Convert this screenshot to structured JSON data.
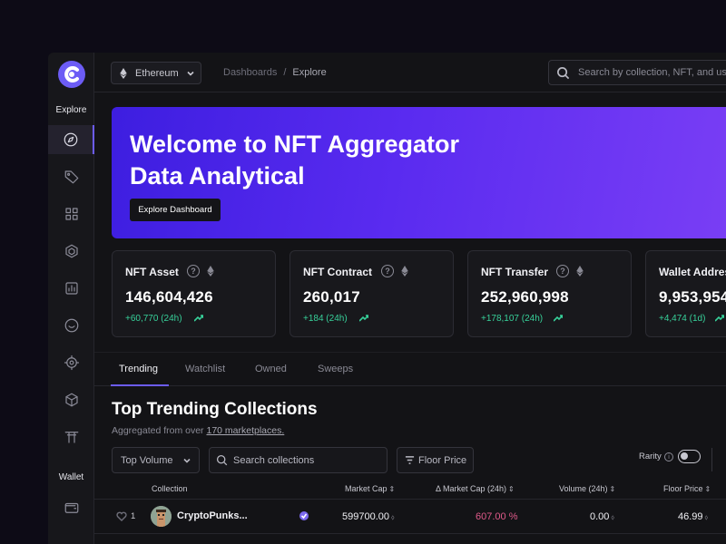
{
  "sidebar": {
    "sections": {
      "explore": "Explore",
      "wallet": "Wallet"
    },
    "items": [
      "compass-icon",
      "tag-icon",
      "grid-icon",
      "cube-outline-icon",
      "chart-icon",
      "smile-icon",
      "target-icon",
      "torii-icon",
      "box-icon",
      "wallet-icon"
    ],
    "active": "compass-icon"
  },
  "topbar": {
    "network": "Ethereum",
    "breadcrumb": {
      "root": "Dashboards",
      "separator": "/",
      "current": "Explore"
    },
    "search_placeholder": "Search by collection, NFT, and user"
  },
  "hero": {
    "title_line1": "Welcome to NFT Aggregator",
    "title_line2": "Data Analytical",
    "button": "Explore Dashboard"
  },
  "stats": [
    {
      "title": "NFT Asset",
      "value": "146,604,426",
      "change": "+60,770 (24h)"
    },
    {
      "title": "NFT Contract",
      "value": "260,017",
      "change": "+184 (24h)"
    },
    {
      "title": "NFT Transfer",
      "value": "252,960,998",
      "change": "+178,107 (24h)"
    },
    {
      "title": "Wallet Address",
      "value": "9,953,954",
      "change": "+4,474 (1d)"
    }
  ],
  "info_glyph": "?",
  "tabs": [
    "Trending",
    "Watchlist",
    "Owned",
    "Sweeps"
  ],
  "active_tab": "Trending",
  "section": {
    "title": "Top Trending Collections",
    "subtitle_prefix": "Aggregated from over ",
    "subtitle_link": "170 marketplaces."
  },
  "filters": {
    "sort": "Top Volume",
    "search_placeholder": "Search collections",
    "floor": "Floor Price",
    "rarity": "Rarity",
    "rarity_info": "i"
  },
  "table": {
    "headers": [
      "Collection",
      "Market Cap",
      "Δ Market Cap (24h)",
      "Volume (24h)",
      "Floor Price"
    ],
    "rows": [
      {
        "rank": "1",
        "name": "CryptoPunks...",
        "market_cap": "599700.00",
        "market_cap_change": "607.00 %",
        "volume": "0.00",
        "floor": "46.99"
      }
    ]
  },
  "colors": {
    "accent": "#6c5cf5",
    "positive": "#37d19a",
    "negative": "#e05a8a",
    "hero_start": "#3d1ee0",
    "hero_end": "#7b3ff5"
  }
}
